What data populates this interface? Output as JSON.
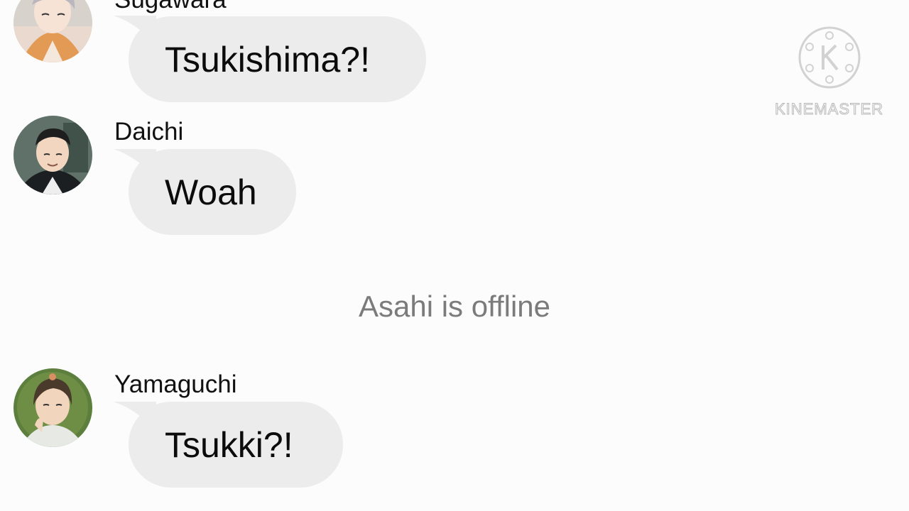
{
  "messages": [
    {
      "sender": "Sugawara",
      "text": "Tsukishima?!"
    },
    {
      "sender": "Daichi",
      "text": "Woah"
    },
    {
      "sender": "Yamaguchi",
      "text": "Tsukki?!"
    }
  ],
  "status": {
    "text": "Asahi is offline"
  },
  "watermark": {
    "text": "KINEMASTER"
  },
  "colors": {
    "background": "#fbfcfb",
    "bubble": "#ebeceb",
    "status_text": "#7b7b7b"
  }
}
